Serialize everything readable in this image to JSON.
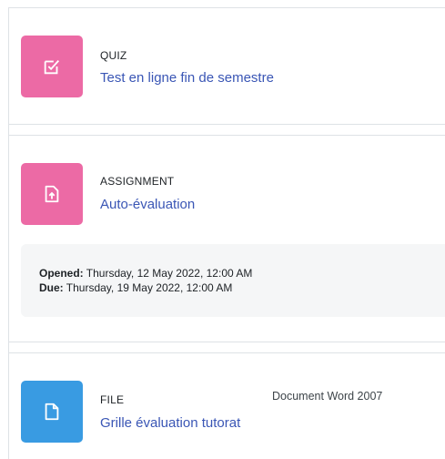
{
  "activities": [
    {
      "type": "QUIZ",
      "title": "Test en ligne fin de semestre",
      "icon": "quiz-checkbox-icon",
      "icon_color": "#ec6aa5"
    },
    {
      "type": "ASSIGNMENT",
      "title": "Auto-évaluation",
      "icon": "assignment-upload-icon",
      "icon_color": "#ec6aa5",
      "dates": {
        "opened_label": "Opened:",
        "opened_value": " Thursday, 12 May 2022, 12:00 AM",
        "due_label": "Due:",
        "due_value": " Thursday, 19 May 2022, 12:00 AM"
      }
    },
    {
      "type": "FILE",
      "title": "Grille évaluation tutorat",
      "meta": "Document Word 2007",
      "icon": "file-document-icon",
      "icon_color": "#399be2"
    }
  ]
}
